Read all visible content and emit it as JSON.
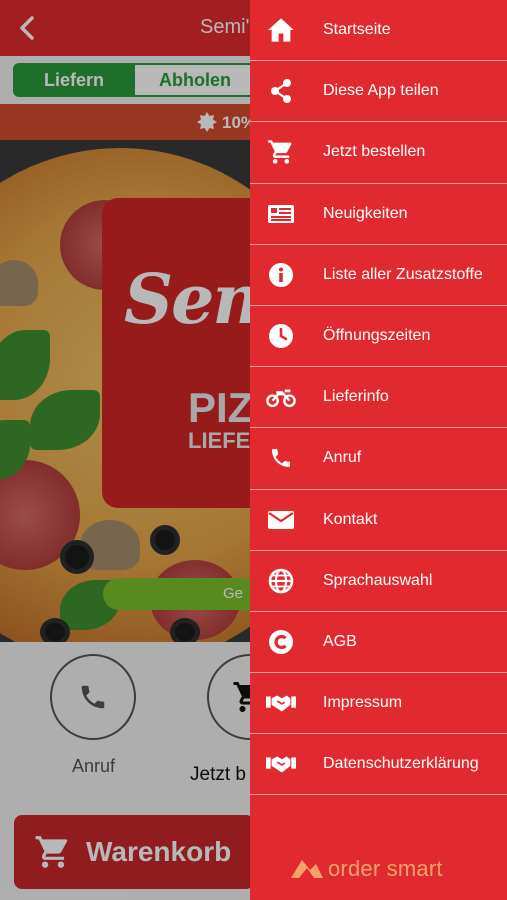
{
  "header": {
    "title": "Semi's"
  },
  "order_mode": {
    "delivery_label": "Liefern",
    "pickup_label": "Abholen"
  },
  "promo": {
    "text": "10%"
  },
  "hero": {
    "logo_script": "Sem",
    "logo_line1": "PIZ",
    "logo_line2": "LIEFER",
    "green_button": "Ge"
  },
  "actions": {
    "call_label": "Anruf",
    "order_label": "Jetzt b"
  },
  "cart": {
    "label": "Warenkorb"
  },
  "drawer": {
    "items": [
      {
        "label": "Startseite",
        "icon": "home-icon"
      },
      {
        "label": "Diese App teilen",
        "icon": "share-icon"
      },
      {
        "label": "Jetzt bestellen",
        "icon": "cart-icon"
      },
      {
        "label": "Neuigkeiten",
        "icon": "news-icon"
      },
      {
        "label": "Liste aller Zusatzstoffe",
        "icon": "info-icon"
      },
      {
        "label": "Öffnungszeiten",
        "icon": "clock-icon"
      },
      {
        "label": "Lieferinfo",
        "icon": "motorcycle-icon"
      },
      {
        "label": "Anruf",
        "icon": "phone-icon"
      },
      {
        "label": "Kontakt",
        "icon": "mail-icon"
      },
      {
        "label": "Sprachauswahl",
        "icon": "globe-icon"
      },
      {
        "label": "AGB",
        "icon": "copyright-icon"
      },
      {
        "label": "Impressum",
        "icon": "handshake-icon"
      },
      {
        "label": "Datenschutzerklärung",
        "icon": "handshake-icon"
      }
    ],
    "brand": "order smart"
  },
  "colors": {
    "brand_red": "#e12a2f",
    "green": "#2c9a3d",
    "lime": "#7cbf2c",
    "brand_orange": "#f5a26a"
  }
}
